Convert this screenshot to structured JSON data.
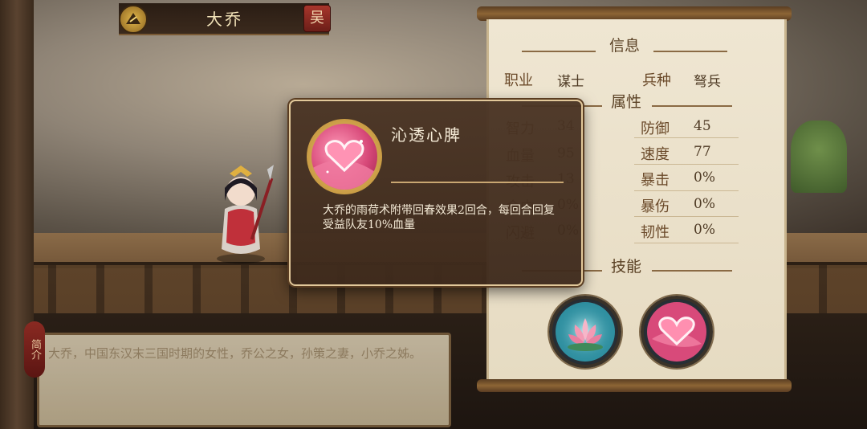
{
  "header": {
    "hero_name": "大乔",
    "kingdom_badge": "吴"
  },
  "info_panel": {
    "title": "信息",
    "class_label": "职业",
    "class_value": "谋士",
    "troop_label": "兵种",
    "troop_value": "弩兵",
    "attributes_title": "属性",
    "stats_left": [
      {
        "label": "智力",
        "value": "34"
      },
      {
        "label": "血量",
        "value": "95"
      },
      {
        "label": "攻击",
        "value": "13"
      },
      {
        "label": "命中",
        "value": "0%"
      },
      {
        "label": "闪避",
        "value": "0%"
      }
    ],
    "stats_right": [
      {
        "label": "防御",
        "value": "45"
      },
      {
        "label": "速度",
        "value": "77"
      },
      {
        "label": "暴击",
        "value": "0%"
      },
      {
        "label": "暴伤",
        "value": "0%"
      },
      {
        "label": "韧性",
        "value": "0%"
      }
    ],
    "skills_title": "技能",
    "skills": [
      {
        "icon": "lotus-icon"
      },
      {
        "icon": "heart-icon"
      }
    ]
  },
  "description": {
    "tag": "简介",
    "text": "大乔，中国东汉末三国时期的女性，乔公之女，孙策之妻，小乔之姊。"
  },
  "popup": {
    "skill_name": "沁透心脾",
    "skill_desc": "大乔的雨荷术附带回春效果2回合，每回合回复受益队友10%血量",
    "icon": "heart-icon"
  }
}
